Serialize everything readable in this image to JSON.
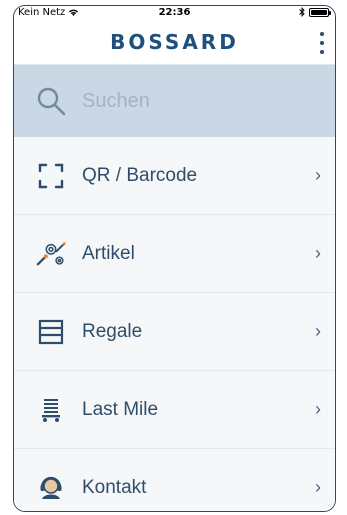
{
  "statusbar": {
    "carrier": "Kein Netz",
    "time": "22:36"
  },
  "appbar": {
    "logo_text": "BOSSARD"
  },
  "search": {
    "placeholder": "Suchen"
  },
  "menu": {
    "items": [
      {
        "label": "QR / Barcode",
        "icon": "qr-scan-icon"
      },
      {
        "label": "Artikel",
        "icon": "tools-icon"
      },
      {
        "label": "Regale",
        "icon": "shelf-icon"
      },
      {
        "label": "Last Mile",
        "icon": "cart-icon"
      },
      {
        "label": "Kontakt",
        "icon": "headset-icon"
      }
    ],
    "chevron": "›"
  },
  "colors": {
    "accent": "#1f4f7c",
    "search_bg": "#c9d8e4",
    "text": "#2f4d6b"
  }
}
